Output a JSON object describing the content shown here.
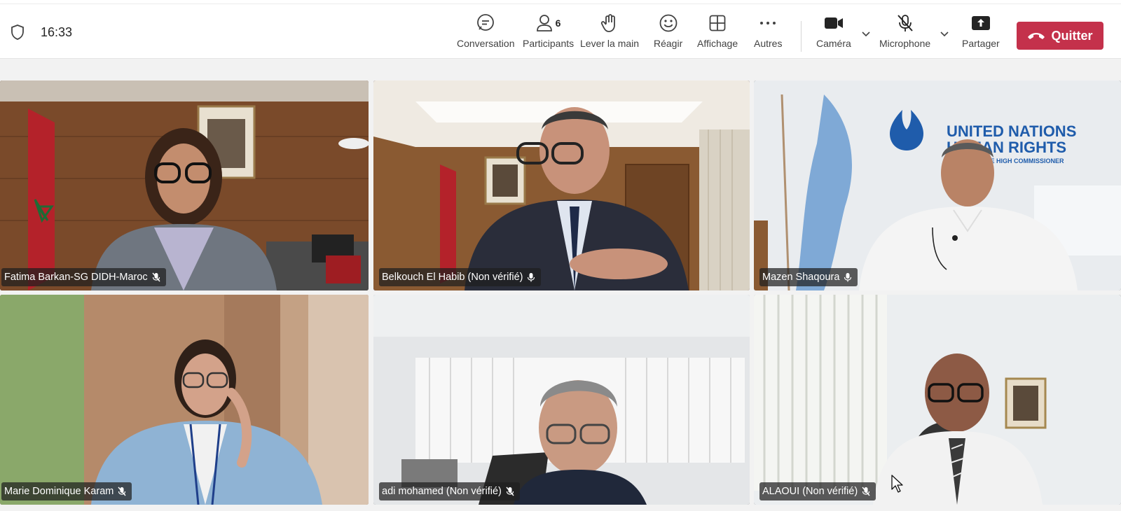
{
  "toolbar": {
    "time": "16:33",
    "conversation": "Conversation",
    "participants": "Participants",
    "participant_count": "6",
    "raise_hand": "Lever la main",
    "react": "Réagir",
    "view": "Affichage",
    "more": "Autres",
    "camera": "Caméra",
    "microphone": "Microphone",
    "share": "Partager",
    "leave": "Quitter"
  },
  "tiles": [
    {
      "name": "Fatima Barkan-SG DIDH-Maroc",
      "mic": "muted"
    },
    {
      "name": "Belkouch El Habib (Non vérifié)",
      "mic": "on"
    },
    {
      "name": "Mazen Shaqoura",
      "mic": "on"
    },
    {
      "name": "Marie Dominique Karam",
      "mic": "muted"
    },
    {
      "name": "adi mohamed (Non vérifié)",
      "mic": "muted"
    },
    {
      "name": "ALAOUI (Non vérifié)",
      "mic": "muted"
    }
  ],
  "backdrop_text": {
    "un_line1": "UNITED NATIONS",
    "un_line2": "HUMAN RIGHTS",
    "un_line3": "OFFICE OF THE HIGH COMMISSIONER"
  },
  "colors": {
    "accent": "#5b5fc7",
    "leave": "#c4314b"
  }
}
